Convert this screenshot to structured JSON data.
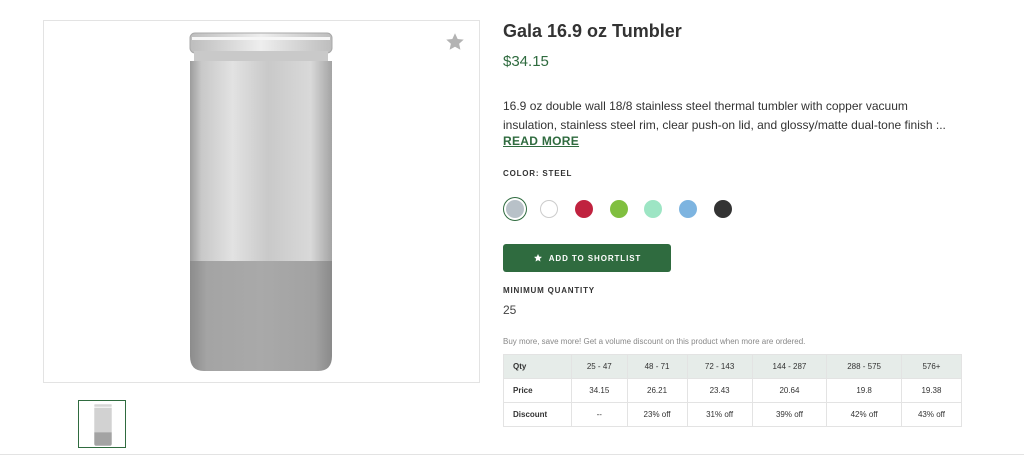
{
  "product": {
    "title": "Gala 16.9 oz Tumbler",
    "price": "$34.15",
    "description": "16.9 oz double wall 18/8 stainless steel thermal tumbler with copper vacuum insulation, stainless steel rim, clear push-on lid, and glossy/matte dual-tone finish :..",
    "read_more": "READ MORE",
    "color_label": "COLOR: STEEL",
    "swatches": [
      {
        "name": "steel",
        "color": "#b8c1c8",
        "selected": true
      },
      {
        "name": "white",
        "color": "#ffffff"
      },
      {
        "name": "red",
        "color": "#c0223f"
      },
      {
        "name": "green",
        "color": "#80bf3f"
      },
      {
        "name": "mint",
        "color": "#9de5c4"
      },
      {
        "name": "light-blue",
        "color": "#7db4e0"
      },
      {
        "name": "black",
        "color": "#333333"
      }
    ],
    "shortlist_button": "ADD TO SHORTLIST",
    "min_qty_label": "MINIMUM QUANTITY",
    "min_qty_value": "25",
    "volume_note": "Buy more, save more! Get a volume discount on this product when more are ordered."
  },
  "pricing_table": {
    "headers": [
      "Qty",
      "25 - 47",
      "48 - 71",
      "72 - 143",
      "144 - 287",
      "288 - 575",
      "576+"
    ],
    "rows": [
      [
        "Price",
        "34.15",
        "26.21",
        "23.43",
        "20.64",
        "19.8",
        "19.38"
      ],
      [
        "Discount",
        "--",
        "23% off",
        "31% off",
        "39% off",
        "42% off",
        "43% off"
      ]
    ]
  },
  "colors": {
    "brand_green": "#2f6b3f",
    "border": "#e3e3e3",
    "table_header_bg": "#e6ece9"
  },
  "icons": {
    "favorite": "star-icon",
    "shortlist": "star-icon"
  }
}
